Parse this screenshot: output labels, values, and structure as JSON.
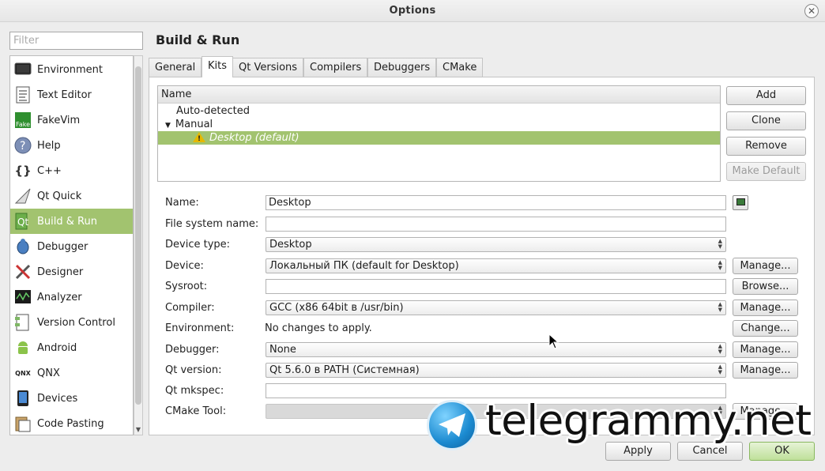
{
  "window": {
    "title": "Options",
    "close_icon": "close-icon"
  },
  "filter": {
    "placeholder": "Filter",
    "value": ""
  },
  "nav": {
    "items": [
      {
        "label": "Environment",
        "icon": "monitor-icon"
      },
      {
        "label": "Text Editor",
        "icon": "text-document-icon"
      },
      {
        "label": "FakeVim",
        "icon": "fakevim-icon"
      },
      {
        "label": "Help",
        "icon": "question-icon"
      },
      {
        "label": "C++",
        "icon": "braces-icon"
      },
      {
        "label": "Qt Quick",
        "icon": "qt-quick-icon"
      },
      {
        "label": "Build & Run",
        "icon": "build-run-icon",
        "active": true
      },
      {
        "label": "Debugger",
        "icon": "bug-icon"
      },
      {
        "label": "Designer",
        "icon": "designer-tools-icon"
      },
      {
        "label": "Analyzer",
        "icon": "oscilloscope-icon"
      },
      {
        "label": "Version Control",
        "icon": "version-control-icon"
      },
      {
        "label": "Android",
        "icon": "android-icon"
      },
      {
        "label": "QNX",
        "icon": "qnx-icon"
      },
      {
        "label": "Devices",
        "icon": "device-icon"
      },
      {
        "label": "Code Pasting",
        "icon": "clipboard-icon"
      }
    ]
  },
  "page": {
    "title": "Build & Run"
  },
  "tabs": [
    "General",
    "Kits",
    "Qt Versions",
    "Compilers",
    "Debuggers",
    "CMake"
  ],
  "active_tab": "Kits",
  "kits": {
    "header": "Name",
    "rows": [
      "Auto-detected",
      "Manual",
      "Desktop (default)"
    ],
    "expand_marker": "▼",
    "buttons": {
      "add": "Add",
      "clone": "Clone",
      "remove": "Remove",
      "make_default": "Make Default"
    }
  },
  "form": {
    "name_label": "Name:",
    "name_value": "Desktop",
    "fs_label": "File system name:",
    "fs_value": "",
    "device_type_label": "Device type:",
    "device_type_value": "Desktop",
    "device_label": "Device:",
    "device_value": "Локальный ПК (default for Desktop)",
    "sysroot_label": "Sysroot:",
    "sysroot_value": "",
    "compiler_label": "Compiler:",
    "compiler_value": "GCC (x86 64bit в /usr/bin)",
    "environment_label": "Environment:",
    "environment_value": "No changes to apply.",
    "debugger_label": "Debugger:",
    "debugger_value": "None",
    "qt_version_label": "Qt version:",
    "qt_version_value": "Qt 5.6.0 в PATH (Системная)",
    "mkspec_label": "Qt mkspec:",
    "mkspec_value": "",
    "cmake_label": "CMake Tool:",
    "cmake_value": "",
    "manage": "Manage...",
    "browse": "Browse...",
    "change": "Change..."
  },
  "dialog_buttons": {
    "apply": "Apply",
    "cancel": "Cancel",
    "ok": "OK"
  },
  "watermark": {
    "text": "telegrammy.net"
  },
  "colors": {
    "selection": "#a2c36f",
    "panel": "#ffffff",
    "background": "#ededed"
  }
}
